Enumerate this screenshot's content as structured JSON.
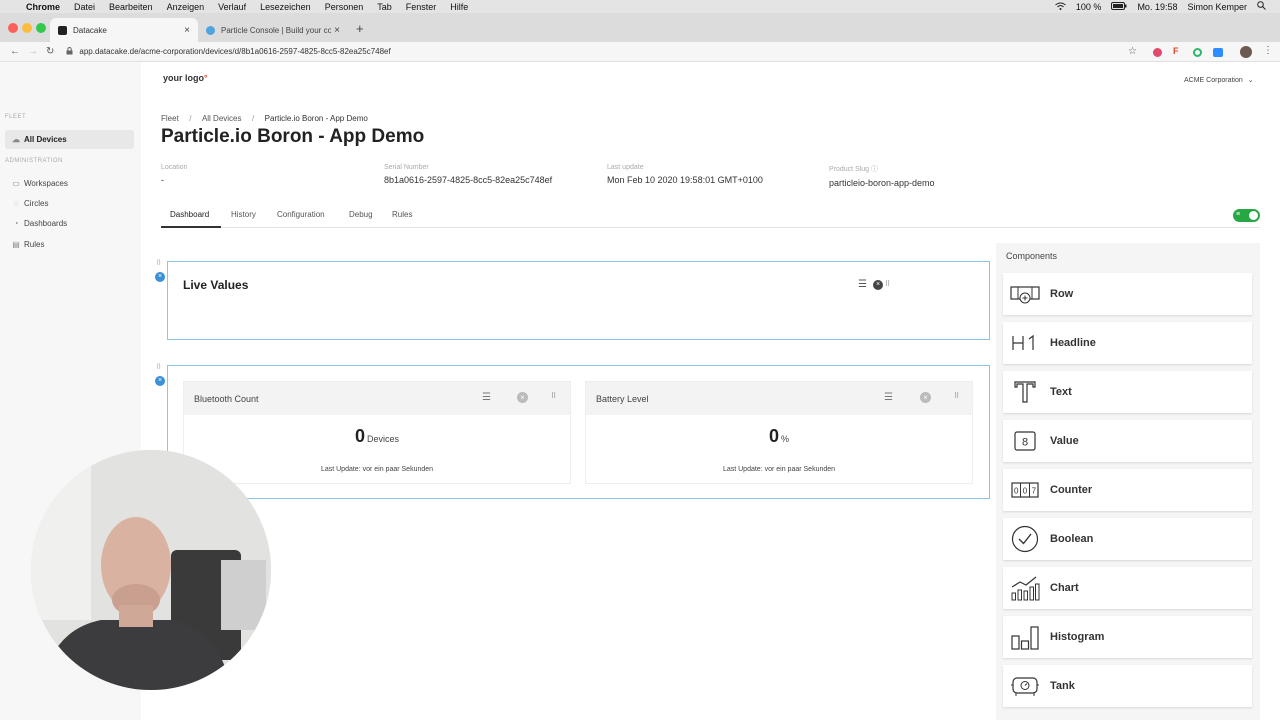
{
  "menubar": {
    "app": "Chrome",
    "items": [
      "Datei",
      "Bearbeiten",
      "Anzeigen",
      "Verlauf",
      "Lesezeichen",
      "Personen",
      "Tab",
      "Fenster",
      "Hilfe"
    ],
    "battery": "100 %",
    "clock": "Mo. 19:58",
    "user": "Simon Kemper"
  },
  "browser": {
    "tabs": [
      {
        "title": "Datacake"
      },
      {
        "title": "Particle Console | Build your con"
      }
    ],
    "url": "app.datacake.de/acme-corporation/devices/d/8b1a0616-2597-4825-8cc5-82ea25c748ef"
  },
  "header": {
    "logo": "your logo",
    "org": "ACME Corporation"
  },
  "sidebar": {
    "fleet_label": "FLEET",
    "fleet_items": [
      {
        "label": "All Devices",
        "icon": "cloud-icon"
      }
    ],
    "admin_label": "ADMINISTRATION",
    "admin_items": [
      {
        "label": "Workspaces",
        "icon": "workspace-icon"
      },
      {
        "label": "Circles",
        "icon": "circle-icon"
      },
      {
        "label": "Dashboards",
        "icon": "dashboard-icon"
      },
      {
        "label": "Rules",
        "icon": "rules-icon"
      }
    ]
  },
  "breadcrumb": [
    "Fleet",
    "All Devices",
    "Particle.io Boron - App Demo"
  ],
  "device": {
    "title": "Particle.io Boron - App Demo",
    "meta": [
      {
        "label": "Location",
        "value": "-"
      },
      {
        "label": "Serial Number",
        "value": "8b1a0616-2597-4825-8cc5-82ea25c748ef"
      },
      {
        "label": "Last update",
        "value": "Mon Feb 10 2020 19:58:01 GMT+0100"
      },
      {
        "label": "Product Slug",
        "value": "particleio-boron-app-demo"
      }
    ]
  },
  "tabs": [
    "Dashboard",
    "History",
    "Configuration",
    "Debug",
    "Rules"
  ],
  "dashboard": {
    "headline": "Live Values",
    "widgets": [
      {
        "title": "Bluetooth Count",
        "value": "0",
        "unit": "Devices",
        "update": "Last Update: vor ein paar Sekunden"
      },
      {
        "title": "Battery Level",
        "value": "0",
        "unit": "%",
        "update": "Last Update: vor ein paar Sekunden"
      }
    ]
  },
  "components": {
    "title": "Components",
    "items": [
      {
        "label": "Row",
        "icon": "row-icon"
      },
      {
        "label": "Headline",
        "icon": "headline-icon"
      },
      {
        "label": "Text",
        "icon": "text-icon"
      },
      {
        "label": "Value",
        "icon": "value-icon"
      },
      {
        "label": "Counter",
        "icon": "counter-icon"
      },
      {
        "label": "Boolean",
        "icon": "boolean-icon"
      },
      {
        "label": "Chart",
        "icon": "chart-icon"
      },
      {
        "label": "Histogram",
        "icon": "histogram-icon"
      },
      {
        "label": "Tank",
        "icon": "tank-icon"
      }
    ]
  },
  "colors": {
    "accent": "#3b8fd6",
    "toggle": "#28a745",
    "row_border": "#8ec4e6"
  }
}
